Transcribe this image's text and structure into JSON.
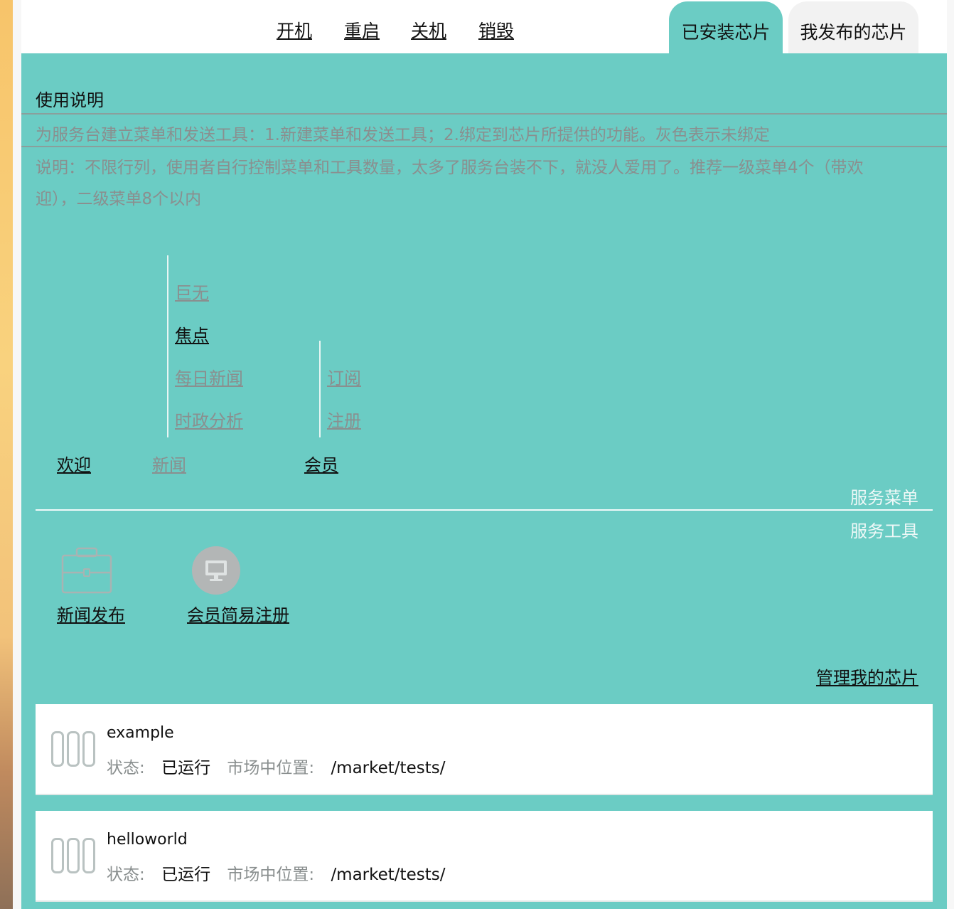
{
  "actions": [
    "开机",
    "重启",
    "关机",
    "销毁"
  ],
  "tabs": {
    "installed": "已安装芯片",
    "published": "我发布的芯片"
  },
  "guide": {
    "title": "使用说明",
    "line1": "为服务台建立菜单和发送工具：1.新建菜单和发送工具；2.绑定到芯片所提供的功能。灰色表示未绑定",
    "line2a": "说明：不限行列，使用者自行控制菜单和工具数量，太多了服务台装不下，就没人爱用了。推荐一级菜单4个（带欢",
    "line2b": "迎），二级菜单8个以内"
  },
  "menu": {
    "top": [
      {
        "label": "欢迎",
        "bound": true
      },
      {
        "label": "新闻",
        "bound": false
      },
      {
        "label": "会员",
        "bound": true
      }
    ],
    "news_sub": [
      {
        "label": "巨无",
        "bound": false
      },
      {
        "label": "焦点",
        "bound": true
      },
      {
        "label": "每日新闻",
        "bound": false
      },
      {
        "label": "时政分析",
        "bound": false
      }
    ],
    "member_sub": [
      {
        "label": "订阅",
        "bound": false
      },
      {
        "label": "注册",
        "bound": false
      }
    ]
  },
  "sections": {
    "menu_label": "服务菜单",
    "tools_label": "服务工具"
  },
  "tools": [
    {
      "label": "新闻发布",
      "icon": "briefcase-icon"
    },
    {
      "label": "会员简易注册",
      "icon": "monitor-icon"
    }
  ],
  "manage_link": "管理我的芯片",
  "chips": [
    {
      "name": "example",
      "status_key": "状态:",
      "status": "已运行",
      "location_key": "市场中位置:",
      "location": "/market/tests/"
    },
    {
      "name": "helloworld",
      "status_key": "状态:",
      "status": "已运行",
      "location_key": "市场中位置:",
      "location": "/market/tests/"
    }
  ],
  "colors": {
    "panel_bg": "#6bccc4",
    "bound_text": "#111111",
    "unbound_text": "#8a8f8f"
  }
}
